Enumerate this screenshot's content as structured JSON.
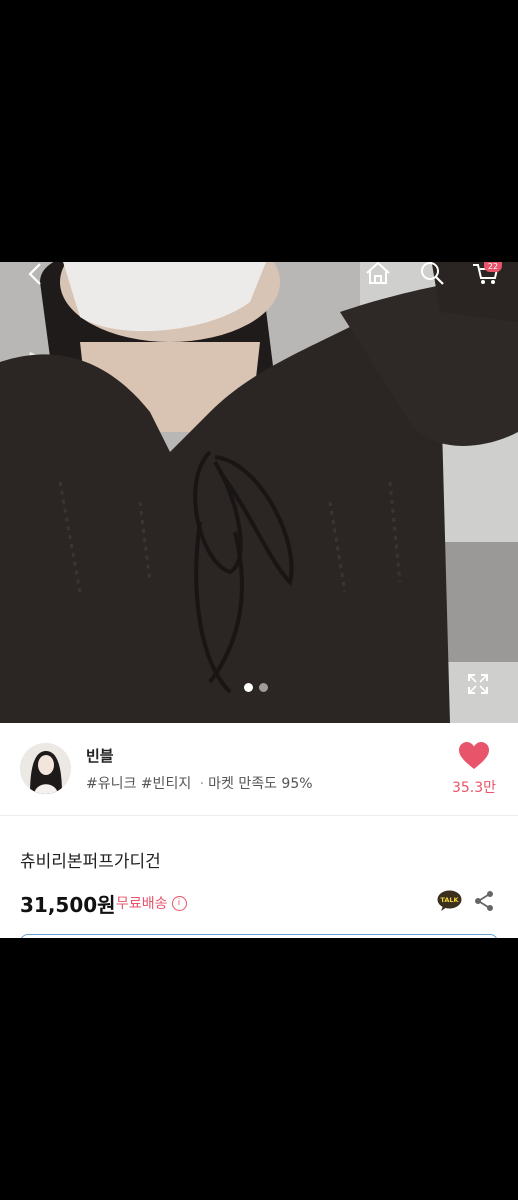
{
  "colors": {
    "accent": "#e8546a",
    "text": "#222222"
  },
  "header": {
    "icons": [
      "chevron-left-icon",
      "home-icon",
      "search-icon",
      "cart-icon"
    ],
    "cart_badge": "22"
  },
  "gallery": {
    "page_count": 2,
    "current_page": 1,
    "expand_icon": "expand-icon"
  },
  "seller": {
    "name": "빈블",
    "tags": [
      "#유니크",
      "#빈티지"
    ],
    "separator": "·",
    "satisfaction": "마켓 만족도 95%",
    "likes": "35.3만"
  },
  "product": {
    "title": "츄비리본퍼프가디건",
    "price": "31,500원",
    "shipping": "무료배송",
    "shipping_info_icon": "i",
    "talk_icon_label": "TALK"
  }
}
